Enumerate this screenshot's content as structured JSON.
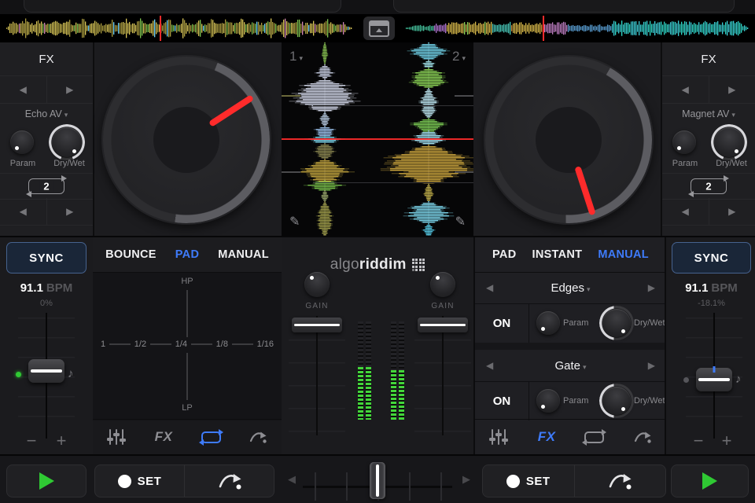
{
  "colors": {
    "accent_blue": "#3e7bfa",
    "green": "#2fc933",
    "vu_green": "#43d63a",
    "red": "#ff2b2b"
  },
  "center_viz": {
    "deck1_label": "1",
    "deck2_label": "2"
  },
  "fx_left": {
    "title": "FX",
    "effect": "Echo AV",
    "param_label": "Param",
    "drywet_label": "Dry/Wet",
    "loop_beats": "2"
  },
  "fx_right": {
    "title": "FX",
    "effect": "Magnet AV",
    "param_label": "Param",
    "drywet_label": "Dry/Wet",
    "loop_beats": "2"
  },
  "sync_left": {
    "label": "SYNC",
    "bpm_value": "91.1",
    "bpm_unit": "BPM",
    "pitch_percent": "0%"
  },
  "sync_right": {
    "label": "SYNC",
    "bpm_value": "91.1",
    "bpm_unit": "BPM",
    "pitch_percent": "-18.1%"
  },
  "pad_left": {
    "tabs": [
      "BOUNCE",
      "PAD",
      "MANUAL"
    ],
    "active": "PAD",
    "filter_top": "HP",
    "filter_bottom": "LP",
    "beat_ticks": [
      "1",
      "1/2",
      "1/4",
      "1/8",
      "1/16"
    ]
  },
  "mixer": {
    "logo_light": "algo",
    "logo_bold": "riddim",
    "gain_label": "GAIN"
  },
  "fx_slots_right": {
    "tabs": [
      "PAD",
      "INSTANT",
      "MANUAL"
    ],
    "active": "MANUAL",
    "slots": [
      {
        "name": "Edges",
        "state": "ON",
        "param_label": "Param",
        "drywet_label": "Dry/Wet"
      },
      {
        "name": "Gate",
        "state": "ON",
        "param_label": "Param",
        "drywet_label": "Dry/Wet"
      }
    ]
  },
  "tools": {
    "fx_label": "FX"
  },
  "transport": {
    "set_left": "SET",
    "set_right": "SET"
  }
}
